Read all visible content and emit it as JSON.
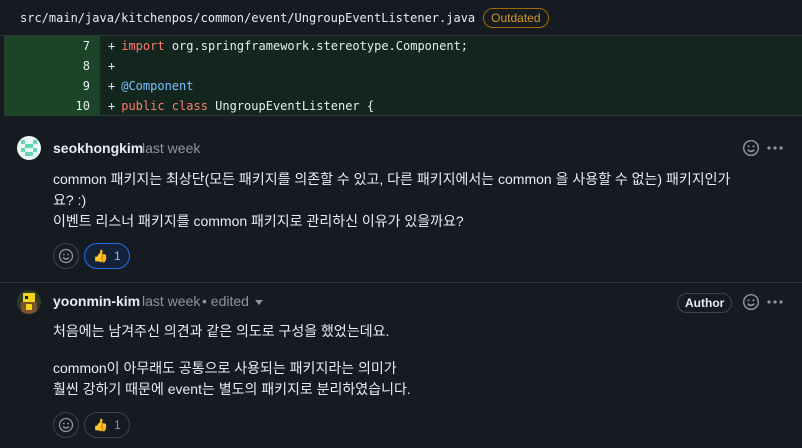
{
  "file": {
    "path": "src/main/java/kitchenpos/common/event/UngroupEventListener.java",
    "badge": "Outdated"
  },
  "diff_lines": [
    {
      "num": "7",
      "prefix": "+",
      "keyword": "import",
      "rest": " org.springframework.stereotype.Component;"
    },
    {
      "num": "8",
      "prefix": "+",
      "keyword": "",
      "rest": ""
    },
    {
      "num": "9",
      "prefix": "+",
      "keyword": "",
      "annotation": "@Component",
      "rest": ""
    },
    {
      "num": "10",
      "prefix": "+",
      "keyword": "public class",
      "rest": " UngroupEventListener {"
    }
  ],
  "comments": [
    {
      "author": "seokhongkim",
      "time": "last week",
      "body_lines": [
        "common 패키지는 최상단(모든 패키지를 의존할 수 있고, 다른 패키지에서는 common 을 사용할 수 없는) 패키지인가",
        "요? :)",
        "이벤트 리스너 패키지를 common 패키지로 관리하신 이유가 있을까요?"
      ],
      "reaction_emoji": "👍",
      "reaction_count": "1"
    },
    {
      "author": "yoonmin-kim",
      "time": "last week",
      "edited": "• edited",
      "badge": "Author",
      "body_lines": [
        "처음에는 남겨주신 의견과 같은 의도로 구성을 했었는데요.",
        "",
        "common이 아무래도 공통으로 사용되는 패키지라는 의미가",
        "훨씬 강하기 때문에 event는 별도의 패키지로 분리하였습니다."
      ],
      "reaction_emoji": "👍",
      "reaction_count": "1"
    }
  ],
  "colors": {
    "background": "#161b22",
    "diff_add_bg": "#12261e",
    "diff_line_num_bg": "#1c4428",
    "outdated": "#d29922",
    "accent": "#1f6feb"
  },
  "icons": [
    "smiley-icon",
    "kebab-menu-icon",
    "caret-down-icon",
    "thumbs-up-icon"
  ]
}
